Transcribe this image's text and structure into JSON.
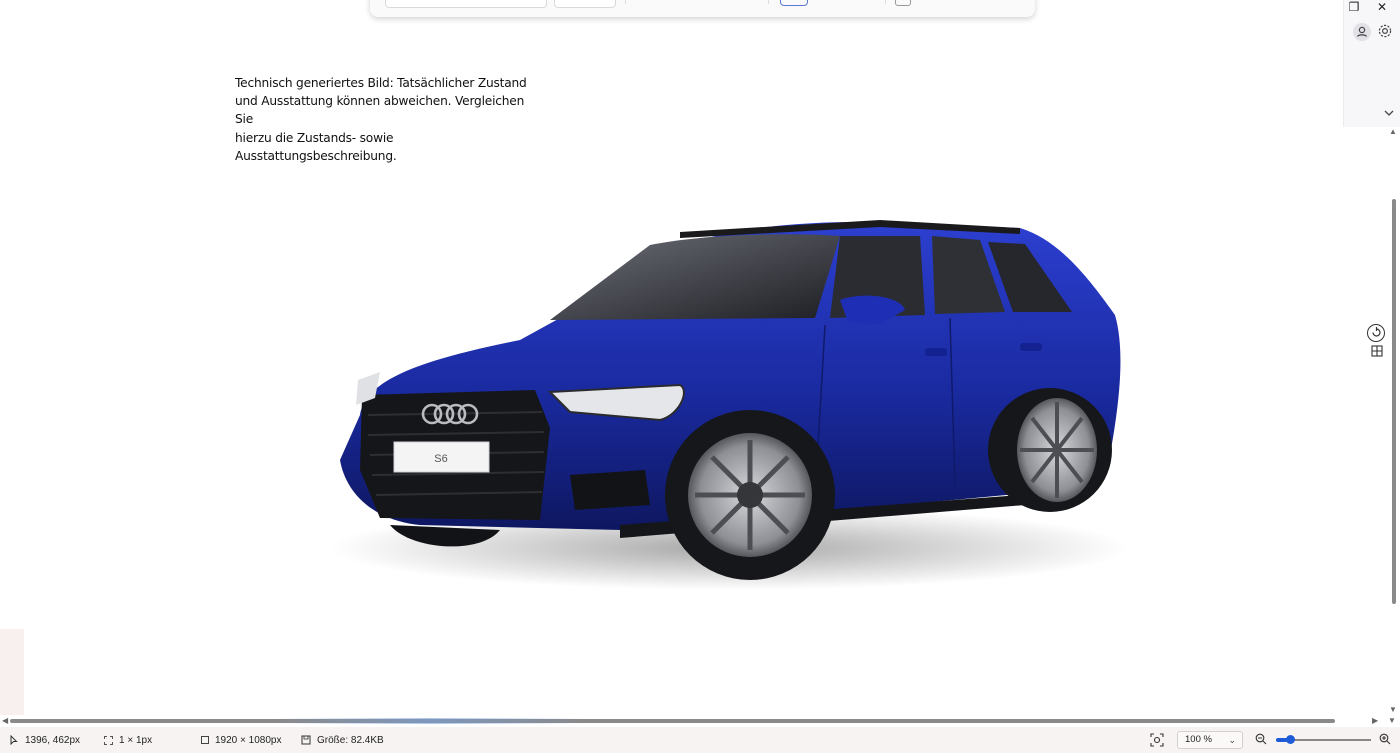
{
  "caption": {
    "line1": "Technisch generiertes Bild: Tatsächlicher Zustand",
    "line2": "und Ausstattung können abweichen. Vergleichen Sie",
    "line3": "hierzu die Zustands- sowie",
    "line4": "Ausstattungsbeschreibung."
  },
  "car": {
    "plate": "S6",
    "body_color": "#1f2fa8",
    "icon": "audi-s6-avant-image"
  },
  "side_panel": {
    "restore_icon": "❐",
    "close_icon": "✕",
    "avatar_icon": "person-icon",
    "gear_icon": "gear-icon"
  },
  "status_bar": {
    "cursor_position": "1396, 462px",
    "selection_size": "1 × 1px",
    "image_dimensions": "1920 × 1080px",
    "file_size": "Größe: 82.4KB",
    "zoom": "100 %"
  },
  "zoom_slider": {
    "value_percent": 100
  }
}
